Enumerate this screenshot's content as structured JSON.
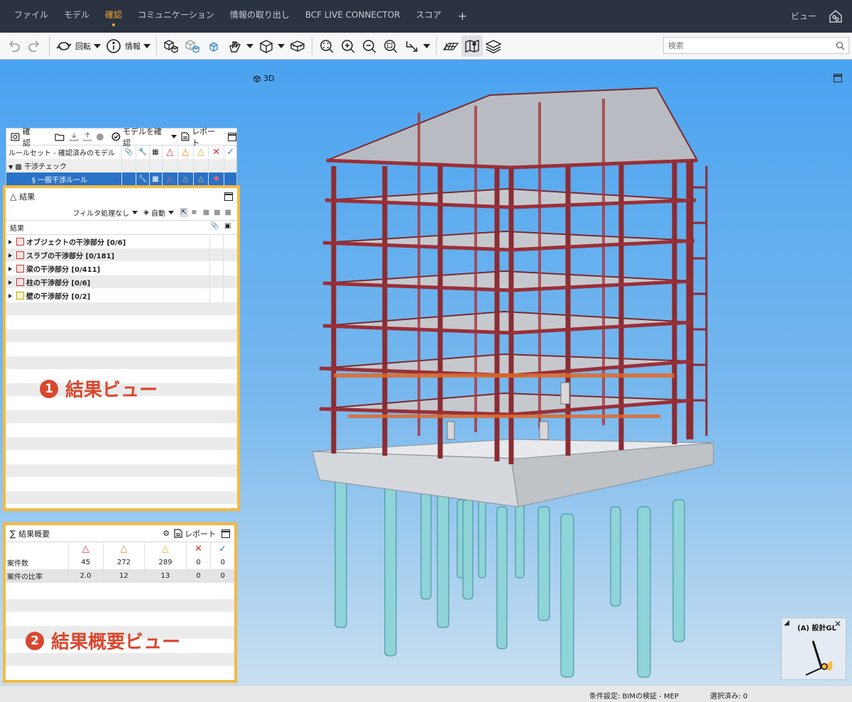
{
  "menubar": {
    "items": [
      {
        "label": "ファイル",
        "active": false
      },
      {
        "label": "モデル",
        "active": false
      },
      {
        "label": "確認",
        "active": true
      },
      {
        "label": "コミュニケーション",
        "active": false
      },
      {
        "label": "情報の取り出し",
        "active": false
      },
      {
        "label": "BCF LIVE CONNECTOR",
        "active": false
      },
      {
        "label": "スコア",
        "active": false
      }
    ],
    "add_tab": "+",
    "view_label": "ビュー"
  },
  "toolbar": {
    "rotate_label": "回転",
    "info_label": "情報",
    "search_placeholder": "検索"
  },
  "check_panel": {
    "title": "確認",
    "check_model_label": "モデルを確認",
    "report_label": "レポート",
    "column_header": "ルールセット - 確認済みのモデル",
    "rows": [
      {
        "label": "干渉チェック",
        "level": 0
      },
      {
        "label": "一般干渉ルール",
        "level": 1,
        "selected": true
      }
    ]
  },
  "results_panel": {
    "title": "結果",
    "filter_label": "フィルタ処理なし",
    "auto_label": "自動",
    "column_header": "結果",
    "rows": [
      {
        "label": "オブジェクトの干渉部分 [0/6]",
        "color": "red"
      },
      {
        "label": "スラブの干渉部分 [0/181]",
        "color": "red"
      },
      {
        "label": "梁の干渉部分 [0/411]",
        "color": "red"
      },
      {
        "label": "柱の干渉部分 [0/6]",
        "color": "red"
      },
      {
        "label": "壁の干渉部分 [0/2]",
        "color": "yellow"
      }
    ],
    "overlay_num": "1",
    "overlay_text": "結果ビュー"
  },
  "summary_panel": {
    "title": "結果概要",
    "report_label": "レポート",
    "rows": [
      {
        "label": "案件数",
        "values": [
          "45",
          "272",
          "289",
          "0",
          "0"
        ]
      },
      {
        "label": "案件の比率",
        "values": [
          "2.0",
          "12",
          "13",
          "0",
          "0"
        ]
      }
    ],
    "overlay_num": "2",
    "overlay_text": "結果概要ビュー"
  },
  "viewport": {
    "label": "3D"
  },
  "navcube": {
    "title": "(A) 設計GL"
  },
  "statusbar": {
    "conditions": "条件設定: BIMの検証 - MEP",
    "selected": "選択済み: 0"
  },
  "colors": {
    "accent": "#f0a830",
    "highlight_border": "#f5b942",
    "selection": "#2a72c8",
    "critical": "#d9302f",
    "major": "#e88a1e",
    "moderate": "#e6b21e",
    "pass": "#2a8ac0"
  },
  "icons": [
    "undo-icon",
    "redo-icon",
    "rotate-icon",
    "info-icon",
    "home-icon",
    "search-icon",
    "zoom-in-icon",
    "zoom-out-icon",
    "layers-icon",
    "map-icon"
  ]
}
